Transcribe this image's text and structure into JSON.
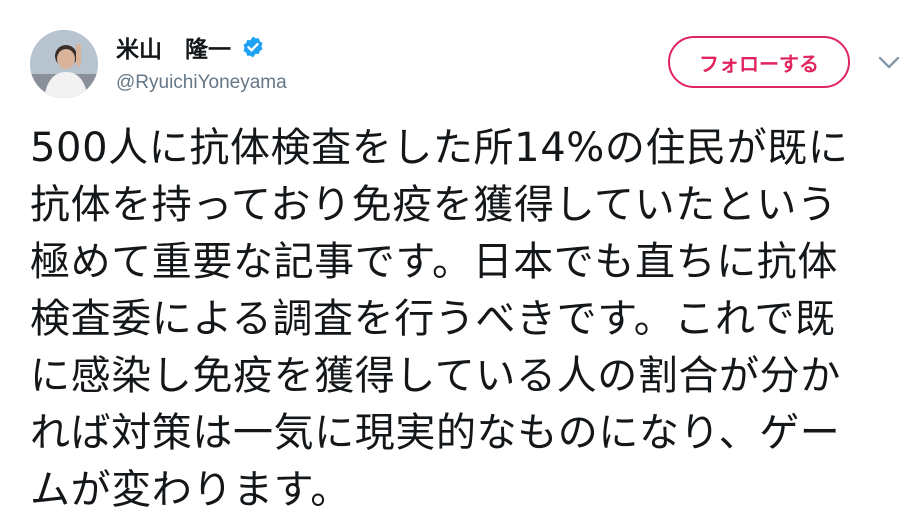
{
  "author": {
    "display_name": "米山　隆一",
    "handle": "@RyuichiYoneyama",
    "verified": true
  },
  "actions": {
    "follow_label": "フォローする"
  },
  "icons": {
    "verified": "verified-badge-icon",
    "more": "chevron-down-icon"
  },
  "colors": {
    "accent": "#e0245e",
    "verified": "#1da1f2",
    "secondary_text": "#657786"
  },
  "tweet": {
    "text": "500人に抗体検査をした所14%の住民が既に\n抗体を持っており免疫を獲得していたという\n極めて重要な記事です。日本でも直ちに抗体\n検査委による調査を行うべきです。これで既\nに感染し免疫を獲得している人の割合が分か\nれば対策は一気に現実的なものになり、ゲー\nムが変わります。"
  }
}
